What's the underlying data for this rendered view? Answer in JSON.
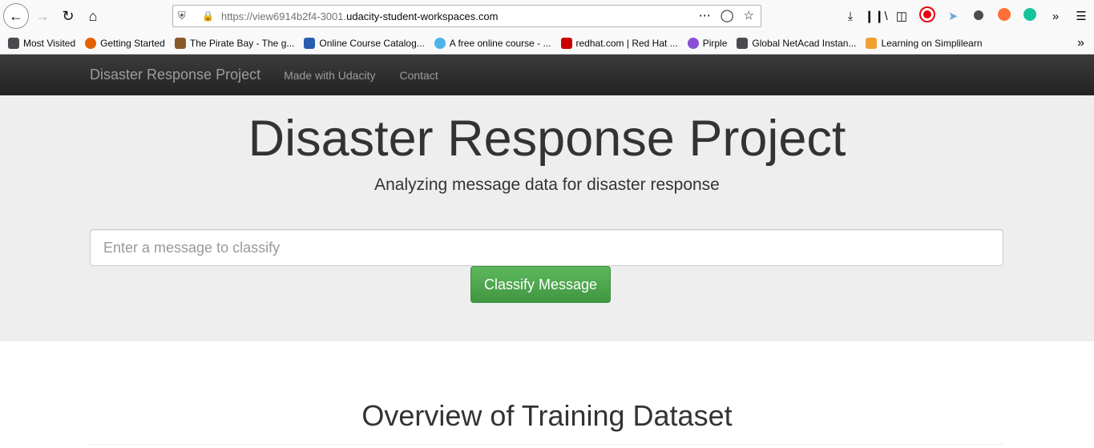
{
  "browser": {
    "url_prefix": "https://view6914b2f4-3001.",
    "url_host": "udacity-student-workspaces.com",
    "bookmarks": [
      {
        "label": "Most Visited",
        "icon": "gear-icon",
        "color": "#4a4a4f"
      },
      {
        "label": "Getting Started",
        "icon": "firefox-icon",
        "color": "#e66000"
      },
      {
        "label": "The Pirate Bay - The g...",
        "icon": "pirate-ship-icon",
        "color": "#8b5a2b"
      },
      {
        "label": "Online Course Catalog...",
        "icon": "infinity-icon",
        "color": "#2a5db0"
      },
      {
        "label": "A free online course - ...",
        "icon": "bubble-icon",
        "color": "#4ab3e8"
      },
      {
        "label": "redhat.com | Red Hat ...",
        "icon": "redhat-icon",
        "color": "#cc0000"
      },
      {
        "label": "Pirple",
        "icon": "pirple-icon",
        "color": "#8a4fd6"
      },
      {
        "label": "Global NetAcad Instan...",
        "icon": "cisco-icon",
        "color": "#4a4a4f"
      },
      {
        "label": "Learning on Simplilearn",
        "icon": "simplilearn-icon",
        "color": "#f0a030"
      }
    ]
  },
  "navbar": {
    "brand": "Disaster Response Project",
    "links": [
      "Made with Udacity",
      "Contact"
    ]
  },
  "jumbotron": {
    "title": "Disaster Response Project",
    "subtitle": "Analyzing message data for disaster response",
    "input_placeholder": "Enter a message to classify",
    "button_label": "Classify Message"
  },
  "overview": {
    "title": "Overview of Training Dataset"
  },
  "colors": {
    "navbar_bg": "#222222",
    "jumbotron_bg": "#eeeeee",
    "button_green": "#5cb85c"
  }
}
